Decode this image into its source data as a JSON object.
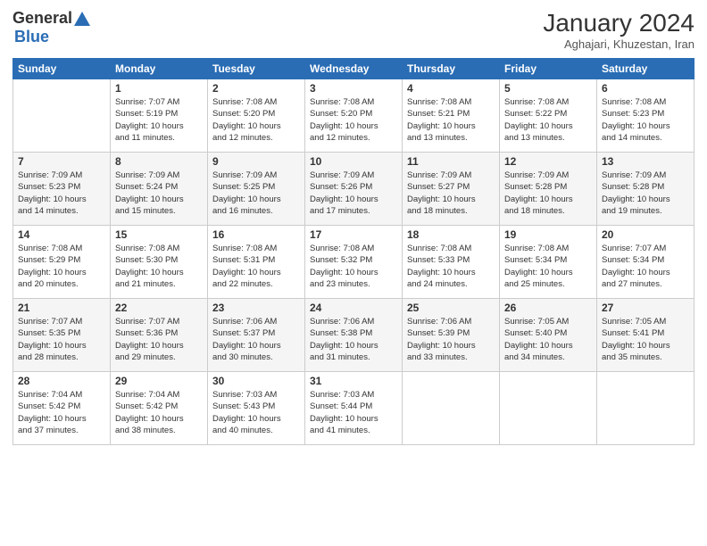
{
  "logo": {
    "line1": "General",
    "line2": "Blue"
  },
  "header": {
    "title": "January 2024",
    "subtitle": "Aghajari, Khuzestan, Iran"
  },
  "weekdays": [
    "Sunday",
    "Monday",
    "Tuesday",
    "Wednesday",
    "Thursday",
    "Friday",
    "Saturday"
  ],
  "weeks": [
    [
      {
        "day": null,
        "info": null
      },
      {
        "day": "1",
        "info": "Sunrise: 7:07 AM\nSunset: 5:19 PM\nDaylight: 10 hours\nand 11 minutes."
      },
      {
        "day": "2",
        "info": "Sunrise: 7:08 AM\nSunset: 5:20 PM\nDaylight: 10 hours\nand 12 minutes."
      },
      {
        "day": "3",
        "info": "Sunrise: 7:08 AM\nSunset: 5:20 PM\nDaylight: 10 hours\nand 12 minutes."
      },
      {
        "day": "4",
        "info": "Sunrise: 7:08 AM\nSunset: 5:21 PM\nDaylight: 10 hours\nand 13 minutes."
      },
      {
        "day": "5",
        "info": "Sunrise: 7:08 AM\nSunset: 5:22 PM\nDaylight: 10 hours\nand 13 minutes."
      },
      {
        "day": "6",
        "info": "Sunrise: 7:08 AM\nSunset: 5:23 PM\nDaylight: 10 hours\nand 14 minutes."
      }
    ],
    [
      {
        "day": "7",
        "info": "Sunrise: 7:09 AM\nSunset: 5:23 PM\nDaylight: 10 hours\nand 14 minutes."
      },
      {
        "day": "8",
        "info": "Sunrise: 7:09 AM\nSunset: 5:24 PM\nDaylight: 10 hours\nand 15 minutes."
      },
      {
        "day": "9",
        "info": "Sunrise: 7:09 AM\nSunset: 5:25 PM\nDaylight: 10 hours\nand 16 minutes."
      },
      {
        "day": "10",
        "info": "Sunrise: 7:09 AM\nSunset: 5:26 PM\nDaylight: 10 hours\nand 17 minutes."
      },
      {
        "day": "11",
        "info": "Sunrise: 7:09 AM\nSunset: 5:27 PM\nDaylight: 10 hours\nand 18 minutes."
      },
      {
        "day": "12",
        "info": "Sunrise: 7:09 AM\nSunset: 5:28 PM\nDaylight: 10 hours\nand 18 minutes."
      },
      {
        "day": "13",
        "info": "Sunrise: 7:09 AM\nSunset: 5:28 PM\nDaylight: 10 hours\nand 19 minutes."
      }
    ],
    [
      {
        "day": "14",
        "info": "Sunrise: 7:08 AM\nSunset: 5:29 PM\nDaylight: 10 hours\nand 20 minutes."
      },
      {
        "day": "15",
        "info": "Sunrise: 7:08 AM\nSunset: 5:30 PM\nDaylight: 10 hours\nand 21 minutes."
      },
      {
        "day": "16",
        "info": "Sunrise: 7:08 AM\nSunset: 5:31 PM\nDaylight: 10 hours\nand 22 minutes."
      },
      {
        "day": "17",
        "info": "Sunrise: 7:08 AM\nSunset: 5:32 PM\nDaylight: 10 hours\nand 23 minutes."
      },
      {
        "day": "18",
        "info": "Sunrise: 7:08 AM\nSunset: 5:33 PM\nDaylight: 10 hours\nand 24 minutes."
      },
      {
        "day": "19",
        "info": "Sunrise: 7:08 AM\nSunset: 5:34 PM\nDaylight: 10 hours\nand 25 minutes."
      },
      {
        "day": "20",
        "info": "Sunrise: 7:07 AM\nSunset: 5:34 PM\nDaylight: 10 hours\nand 27 minutes."
      }
    ],
    [
      {
        "day": "21",
        "info": "Sunrise: 7:07 AM\nSunset: 5:35 PM\nDaylight: 10 hours\nand 28 minutes."
      },
      {
        "day": "22",
        "info": "Sunrise: 7:07 AM\nSunset: 5:36 PM\nDaylight: 10 hours\nand 29 minutes."
      },
      {
        "day": "23",
        "info": "Sunrise: 7:06 AM\nSunset: 5:37 PM\nDaylight: 10 hours\nand 30 minutes."
      },
      {
        "day": "24",
        "info": "Sunrise: 7:06 AM\nSunset: 5:38 PM\nDaylight: 10 hours\nand 31 minutes."
      },
      {
        "day": "25",
        "info": "Sunrise: 7:06 AM\nSunset: 5:39 PM\nDaylight: 10 hours\nand 33 minutes."
      },
      {
        "day": "26",
        "info": "Sunrise: 7:05 AM\nSunset: 5:40 PM\nDaylight: 10 hours\nand 34 minutes."
      },
      {
        "day": "27",
        "info": "Sunrise: 7:05 AM\nSunset: 5:41 PM\nDaylight: 10 hours\nand 35 minutes."
      }
    ],
    [
      {
        "day": "28",
        "info": "Sunrise: 7:04 AM\nSunset: 5:42 PM\nDaylight: 10 hours\nand 37 minutes."
      },
      {
        "day": "29",
        "info": "Sunrise: 7:04 AM\nSunset: 5:42 PM\nDaylight: 10 hours\nand 38 minutes."
      },
      {
        "day": "30",
        "info": "Sunrise: 7:03 AM\nSunset: 5:43 PM\nDaylight: 10 hours\nand 40 minutes."
      },
      {
        "day": "31",
        "info": "Sunrise: 7:03 AM\nSunset: 5:44 PM\nDaylight: 10 hours\nand 41 minutes."
      },
      {
        "day": null,
        "info": null
      },
      {
        "day": null,
        "info": null
      },
      {
        "day": null,
        "info": null
      }
    ]
  ]
}
